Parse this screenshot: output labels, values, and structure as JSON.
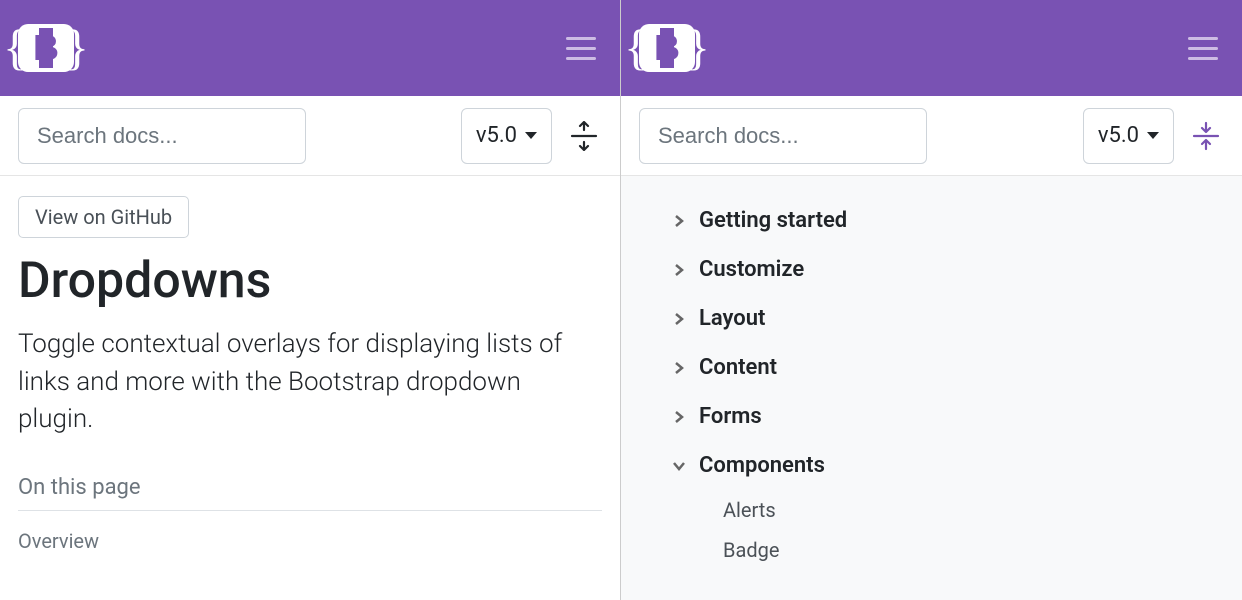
{
  "left": {
    "search_placeholder": "Search docs...",
    "version": "v5.0",
    "github_label": "View on GitHub",
    "title": "Dropdowns",
    "lead": "Toggle contextual overlays for displaying lists of links and more with the Bootstrap dropdown plugin.",
    "toc_heading": "On this page",
    "toc_items": [
      "Overview"
    ]
  },
  "right": {
    "search_placeholder": "Search docs...",
    "version": "v5.0",
    "sections": [
      {
        "label": "Getting started",
        "expanded": false
      },
      {
        "label": "Customize",
        "expanded": false
      },
      {
        "label": "Layout",
        "expanded": false
      },
      {
        "label": "Content",
        "expanded": false
      },
      {
        "label": "Forms",
        "expanded": false
      },
      {
        "label": "Components",
        "expanded": true,
        "children": [
          "Alerts",
          "Badge"
        ]
      }
    ]
  }
}
